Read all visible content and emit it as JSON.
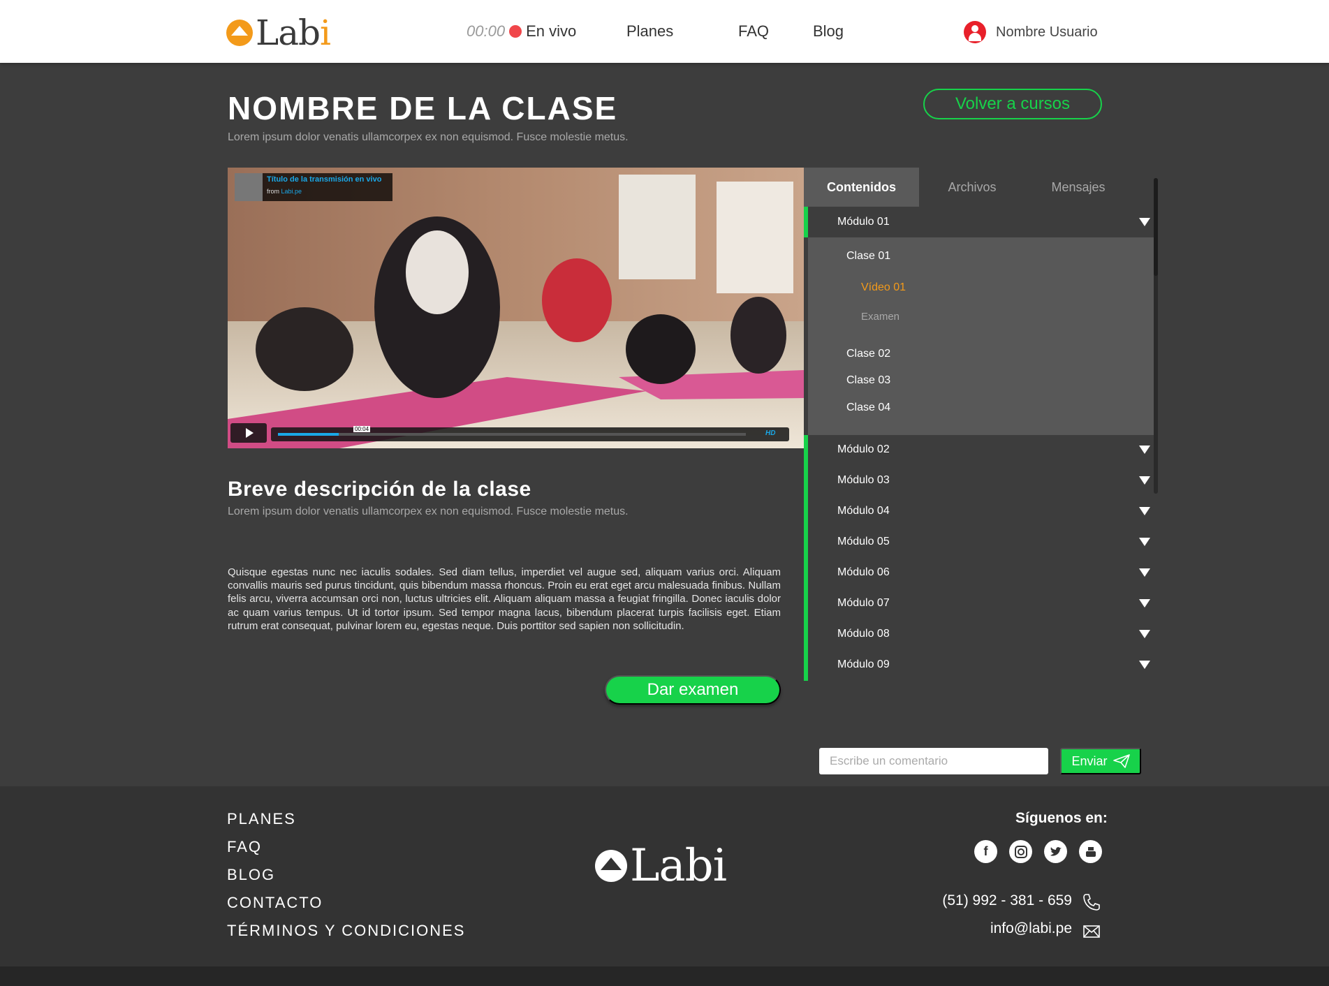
{
  "header": {
    "logo": "Labi",
    "live_time": "00:00",
    "live_label": "En vivo",
    "nav": [
      "Planes",
      "FAQ",
      "Blog"
    ],
    "user_name": "Nombre Usuario"
  },
  "page": {
    "title": "NOMBRE DE LA CLASE",
    "subtitle": "Lorem ipsum dolor venatis ullamcorpex ex non equismod. Fusce molestie metus.",
    "back_button": "Volver a cursos"
  },
  "video": {
    "stream_title": "Título de la transmisión en vivo",
    "from_label": "from",
    "from_source": "Labi.pe",
    "progress_time": "00:04",
    "quality": "HD",
    "progress": 0.13
  },
  "description": {
    "title": "Breve descripción de la clase",
    "subtitle": "Lorem ipsum dolor venatis ullamcorpex ex non equismod. Fusce molestie metus.",
    "body": "Quisque egestas nunc nec iaculis sodales. Sed diam tellus, imperdiet vel augue sed, aliquam varius orci. Aliquam convallis mauris sed purus tincidunt, quis bibendum massa rhoncus. Proin eu erat eget arcu malesuada finibus. Nullam felis arcu, viverra accumsan orci non, luctus ultricies elit. Aliquam aliquam massa a feugiat fringilla. Donec iaculis dolor ac quam varius tempus. Ut id tortor ipsum. Sed tempor magna lacus, bibendum placerat turpis facilisis eget. Etiam rutrum erat consequat, pulvinar lorem eu, egestas neque. Duis porttitor sed sapien non sollicitudin.",
    "exam_button": "Dar examen"
  },
  "sidebar": {
    "tabs": [
      "Contenidos",
      "Archivos",
      "Mensajes"
    ],
    "modules": [
      "Módulo 01",
      "Módulo 02",
      "Módulo 03",
      "Módulo 04",
      "Módulo 05",
      "Módulo 06",
      "Módulo 07",
      "Módulo 08",
      "Módulo 09"
    ],
    "expanded": {
      "classes": [
        "Clase 01",
        "Clase 02",
        "Clase 03",
        "Clase 04"
      ],
      "video": "Vídeo 01",
      "exam": "Examen"
    }
  },
  "comment": {
    "placeholder": "Escribe un comentario",
    "send_button": "Enviar"
  },
  "footer": {
    "links": [
      "PLANES",
      "FAQ",
      "BLOG",
      "CONTACTO",
      "TÉRMINOS Y CONDICIONES"
    ],
    "logo": "Labi",
    "follow_label": "Síguenos en:",
    "social": [
      "facebook-icon",
      "instagram-icon",
      "twitter-icon",
      "youtube-icon"
    ],
    "phone": "(51) 992 - 381 - 659",
    "email": "info@labi.pe"
  },
  "colors": {
    "accent_green": "#17d24a",
    "brand_orange": "#f39a1a",
    "live_red": "#f0464a",
    "background": "#3d3d3d"
  }
}
